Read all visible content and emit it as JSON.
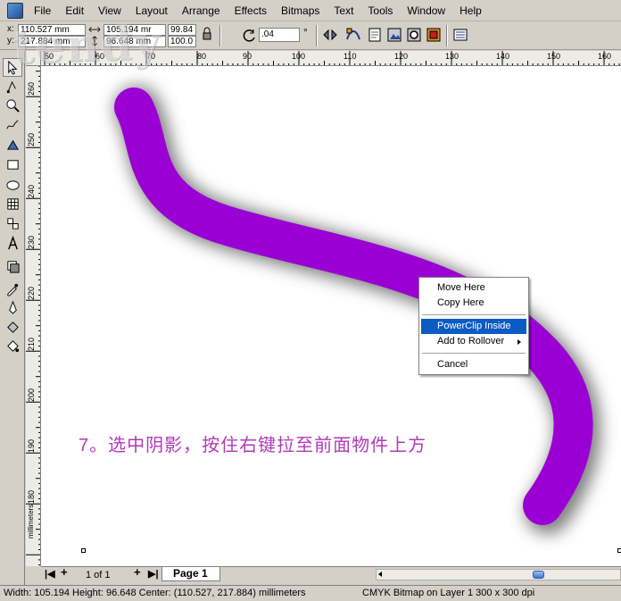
{
  "menubar": {
    "items": [
      "File",
      "Edit",
      "View",
      "Layout",
      "Arrange",
      "Effects",
      "Bitmaps",
      "Text",
      "Tools",
      "Window",
      "Help"
    ]
  },
  "propbar": {
    "x_label": "x:",
    "x_value": "110.527 mm",
    "y_label": "y:",
    "y_value": "217.884 mm",
    "width_value": "105.194 mr",
    "height_value": "96.648 mm",
    "scale_x": "99.84",
    "scale_y": "100.0",
    "rotation_value": ".04",
    "degree_symbol": "°"
  },
  "watermark": "tendy",
  "rulers": {
    "top_labels": [
      "50",
      "60",
      "70",
      "80",
      "90",
      "100",
      "110",
      "120",
      "130",
      "140",
      "150",
      "160"
    ],
    "left_labels": [
      "260",
      "250",
      "240",
      "230",
      "220",
      "210",
      "200",
      "190",
      "180"
    ],
    "units": "millimeters"
  },
  "canvas": {
    "shape_color": "#9a00d4",
    "caption": "7。选中阴影，按住右键拉至前面物件上方"
  },
  "context_menu": {
    "items": [
      {
        "label": "Move Here"
      },
      {
        "label": "Copy Here"
      },
      {
        "label": "PowerClip Inside",
        "highlighted": true
      },
      {
        "label": "Add to Rollover",
        "submenu": true
      },
      {
        "label": "Cancel"
      }
    ]
  },
  "pagebar": {
    "page_count": "1 of 1",
    "page_tab": "Page 1"
  },
  "statusbar": {
    "left": "Width: 105.194  Height: 96.648  Center: (110.527, 217.884)  millimeters",
    "right": "CMYK Bitmap on Layer 1 300 x 300 dpi"
  }
}
